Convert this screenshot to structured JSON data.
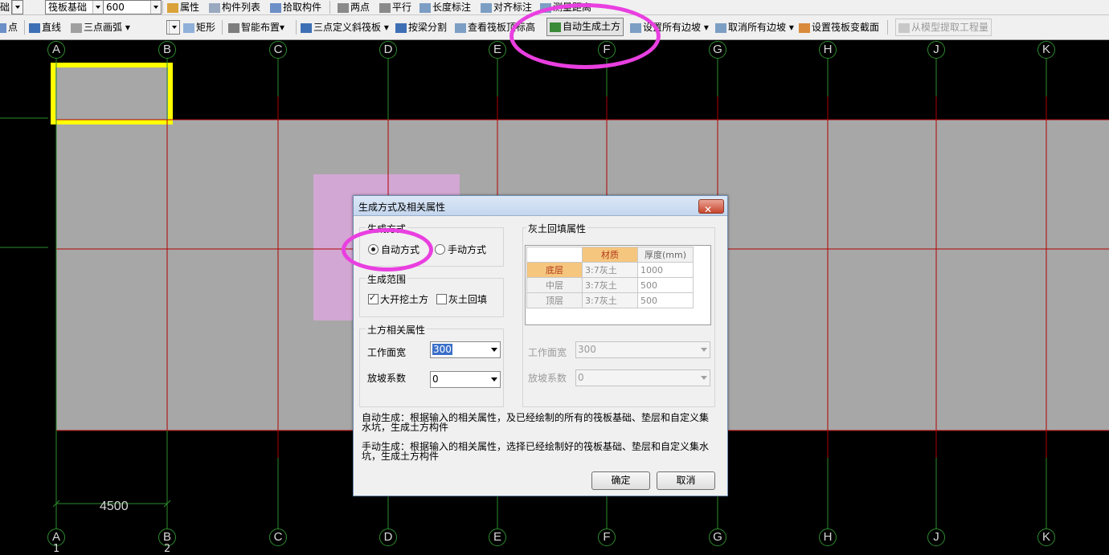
{
  "toolbar_row1": {
    "partial_left": "础",
    "type_select": "筏板基础",
    "size_select": "600",
    "attr_button": "属性",
    "list_button": "构件列表",
    "pick_button": "拾取构件",
    "two_points": "两点",
    "parallel": "平行",
    "length_dim": "长度标注",
    "align_dim": "对齐标注",
    "measure": "测量距离"
  },
  "toolbar_row2": {
    "point": "点",
    "line": "直线",
    "arc_select": "三点画弧",
    "rect": "矩形",
    "smart_layout": "智能布置",
    "slope_raft": "三点定义斜筏板",
    "beam_split": "按梁分割",
    "view_elev": "查看筏板顶标高",
    "auto_earth": "自动生成土方",
    "set_slopes": "设置所有边坡",
    "cancel_slopes": "取消所有边坡",
    "set_section": "设置筏板变截面",
    "extract": "从模型提取工程量"
  },
  "axes": {
    "labels": [
      "A",
      "B",
      "C",
      "D",
      "E",
      "F",
      "G",
      "H",
      "J",
      "K"
    ],
    "bottom_numbers": [
      "1",
      "2"
    ],
    "dimension": "4500"
  },
  "colors": {
    "raft": "#a7a7a7",
    "grid_red": "#b00000",
    "grid_green": "#2d8c2d",
    "highlight": "#ffff00",
    "annotation": "#e93fe0",
    "pink_region": "#d3a7d3"
  },
  "dialog": {
    "title": "生成方式及相关属性",
    "close": "✕",
    "gen_mode": {
      "label": "生成方式",
      "auto": "自动方式",
      "manual": "手动方式",
      "selected": "auto"
    },
    "gen_range": {
      "label": "生成范围",
      "big_excavation": "大开挖土方",
      "lime_backfill": "灰土回填",
      "big_excavation_checked": true,
      "lime_backfill_checked": false
    },
    "earth_props": {
      "label": "土方相关属性",
      "work_width_label": "工作面宽",
      "work_width": "300",
      "slope_label": "放坡系数",
      "slope": "0"
    },
    "lime_props": {
      "label": "灰土回填属性",
      "headers": [
        "材质",
        "厚度(mm)"
      ],
      "rows": [
        {
          "layer": "底层",
          "material": "3:7灰土",
          "thickness": "1000"
        },
        {
          "layer": "中层",
          "material": "3:7灰土",
          "thickness": "500"
        },
        {
          "layer": "顶层",
          "material": "3:7灰土",
          "thickness": "500"
        }
      ],
      "work_width_label": "工作面宽",
      "work_width": "300",
      "slope_label": "放坡系数",
      "slope": "0"
    },
    "desc_auto": "自动生成：根据输入的相关属性，及已经绘制的所有的筏板基础、垫层和自定义集水坑，生成土方构件",
    "desc_manual": "手动生成：根据输入的相关属性，选择已经绘制好的筏板基础、垫层和自定义集水坑，生成土方构件",
    "ok": "确定",
    "cancel": "取消"
  }
}
